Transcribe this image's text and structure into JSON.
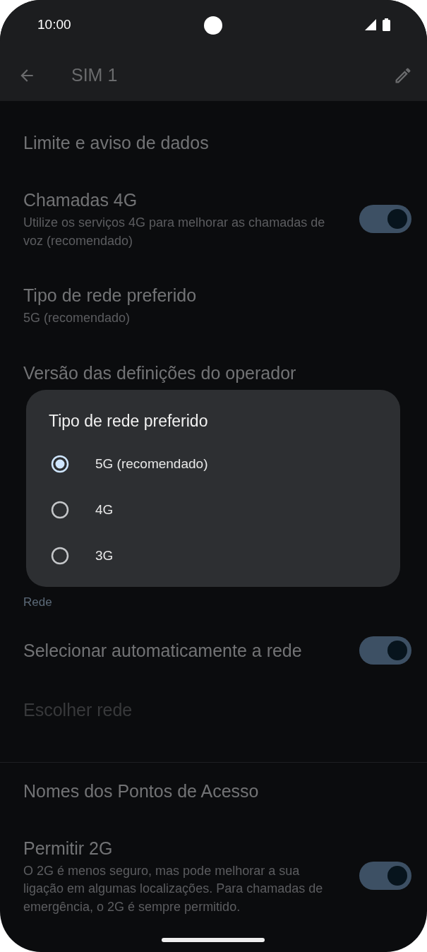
{
  "status_bar": {
    "time": "10:00"
  },
  "app_bar": {
    "title": "SIM 1"
  },
  "settings": [
    {
      "kind": "item",
      "title": "Limite e aviso de dados"
    },
    {
      "kind": "switch",
      "title": "Chamadas 4G",
      "summary": "Utilize os serviços 4G para melhorar as chamadas de voz (recomendado)",
      "on": true
    },
    {
      "kind": "item",
      "title": "Tipo de rede preferido",
      "summary": "5G (recomendado)"
    },
    {
      "kind": "item",
      "title": "Versão das definições do operador"
    },
    {
      "kind": "header",
      "title": "Rede"
    },
    {
      "kind": "switch",
      "title": "Selecionar automaticamente a rede",
      "on": true
    },
    {
      "kind": "item",
      "title": "Escolher rede",
      "disabled": true
    },
    {
      "kind": "divider"
    },
    {
      "kind": "item",
      "title": "Nomes dos Pontos de Acesso"
    },
    {
      "kind": "switch",
      "title": "Permitir 2G",
      "summary": "O 2G é menos seguro, mas pode melhorar a sua ligação em algumas localizações. Para chamadas de emergência, o 2G é sempre permitido.",
      "on": true
    }
  ],
  "dialog": {
    "title": "Tipo de rede preferido",
    "options": [
      {
        "label": "5G (recomendado)",
        "selected": true
      },
      {
        "label": "4G",
        "selected": false
      },
      {
        "label": "3G",
        "selected": false
      }
    ]
  }
}
